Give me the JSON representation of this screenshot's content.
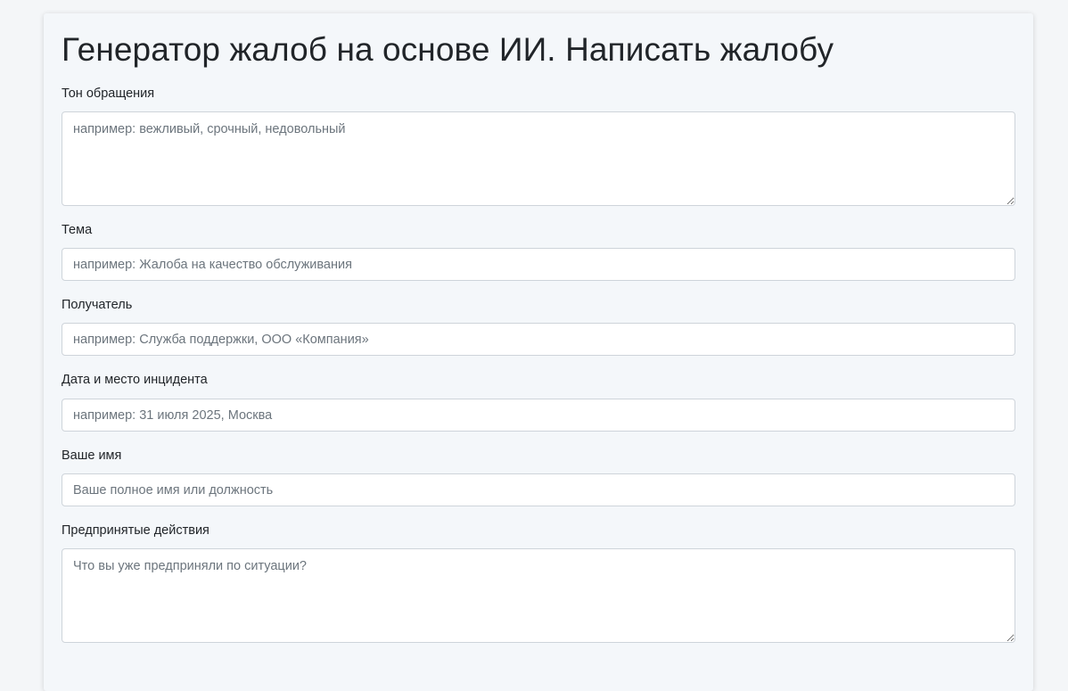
{
  "page": {
    "title": "Генератор жалоб на основе ИИ. Написать жалобу"
  },
  "form": {
    "tone": {
      "label": "Тон обращения",
      "placeholder": "например: вежливый, срочный, недовольный"
    },
    "subject": {
      "label": "Тема",
      "placeholder": "например: Жалоба на качество обслуживания"
    },
    "recipient": {
      "label": "Получатель",
      "placeholder": "например: Служба поддержки, ООО «Компания»"
    },
    "incident": {
      "label": "Дата и место инцидента",
      "placeholder": "например: 31 июля 2025, Москва"
    },
    "name": {
      "label": "Ваше имя",
      "placeholder": "Ваше полное имя или должность"
    },
    "actions": {
      "label": "Предпринятые действия",
      "placeholder": "Что вы уже предприняли по ситуации?"
    }
  }
}
